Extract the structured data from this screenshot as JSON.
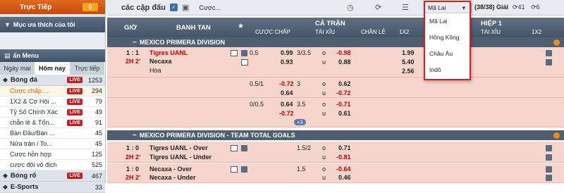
{
  "sidebar": {
    "live_label": "Trực Tiếp",
    "live_count": "0",
    "favorites_label": "Mục ưa thích của tôi",
    "menu_label": "ẩn Menu",
    "tabs": [
      "Ngày mai",
      "Hôm nay",
      "Trực tiếp"
    ],
    "sports": [
      {
        "name": "Bóng đá",
        "live": "LIVE",
        "count": "1253"
      },
      {
        "name": "Bóng rổ",
        "live": "LIVE",
        "count": "467"
      },
      {
        "name": "E-Sports",
        "live": "",
        "count": "33"
      }
    ],
    "football_items": [
      {
        "name": "Cược chấp ...",
        "live": "LIVE",
        "count": "294"
      },
      {
        "name": "1X2 & Cơ Hội ...",
        "live": "LIVE",
        "count": "79"
      },
      {
        "name": "Tỷ Số Chính Xác",
        "live": "LIVE",
        "count": "49"
      },
      {
        "name": "chẵn lẻ & Tổn...",
        "live": "LIVE",
        "count": "91"
      },
      {
        "name": "Bàn Đầu/Bàn ...",
        "live": "",
        "count": "45"
      },
      {
        "name": "Nửa trận / To...",
        "live": "",
        "count": "45"
      },
      {
        "name": "Cược hỗn hợp",
        "live": "",
        "count": "125"
      },
      {
        "name": "cược đội vô địch",
        "live": "",
        "count": "525"
      }
    ]
  },
  "toolbar": {
    "title": "các cặp đấu",
    "bet_label": "Cược...",
    "odds_type": "Mã Lai",
    "ratio": "(38/38) Giải",
    "count_a": "41",
    "count_b": "6"
  },
  "header": {
    "time": "GIỜ",
    "teams": "BANH TAN",
    "full_match": "CẢ TRẬN",
    "half": "HIỆP 1",
    "handicap": "CƯỢC CHẤP",
    "over_under": "TÀI XỈU",
    "odd_even": "CHẴN LẺ",
    "x12": "1X2",
    "over_under2": "TÀI XỈU",
    "x12_2": "1X2"
  },
  "leagues": [
    "MEXICO PRIMERA DIVISION",
    "MEXICO PRIMERA DIVISION - TEAM TOTAL GOALS"
  ],
  "matches": [
    {
      "score": "1 : 1",
      "time": "2H 2'",
      "home": "Tigres UANL",
      "away": "Necaxa",
      "draw": "Hòa",
      "hdp": "0.5",
      "hdp_home": "0.99",
      "hdp_away": "0.93",
      "ou": "3/3.5",
      "ou_over": "-0.98",
      "ou_under": "0.88",
      "x1": "1.99",
      "x2": "5.40",
      "xd": "2.56"
    },
    {
      "hdp": "0.5/1",
      "hdp_home": "-0.72",
      "hdp_away": "0.64",
      "ou": "3",
      "ou_over": "0.62",
      "ou_under": "-0.72"
    },
    {
      "hdp": "0/0.5",
      "hdp_home": "0.64",
      "hdp_away": "-0.72",
      "ou": "3.5",
      "ou_over": "-0.71",
      "ou_under": "0.61",
      "more": "+3"
    },
    {
      "score": "1 : 0",
      "time": "2H 2'",
      "home": "Tigres UANL - Over",
      "away": "Tigres UANL - Under",
      "ou": "1.5/2",
      "ou_over": "0.71",
      "ou_under": "-0.81"
    },
    {
      "score": "1 : 0",
      "time": "2H 2'",
      "home": "Necaxa - Over",
      "away": "Necaxa - Under",
      "ou": "1.5",
      "ou_over": "-0.64",
      "ou_under": "0.46"
    }
  ],
  "dropdown": {
    "selected": "Mã Lai",
    "options": [
      "Mã Lai",
      "Hồng Kông",
      "Châu Âu",
      "Indô"
    ]
  },
  "colors": {
    "accent": "#e06a1c",
    "header": "#4f5f72",
    "row": "#f6d6cc",
    "live": "#cc1a1a",
    "highlight_border": "#d81f1f"
  }
}
